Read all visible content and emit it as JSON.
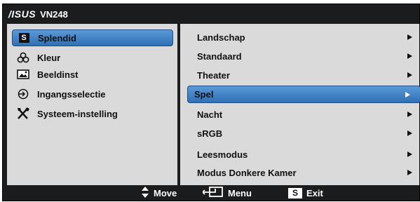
{
  "title": {
    "brand": "/ISUS",
    "model": "VN248"
  },
  "main_menu": [
    {
      "label": "Splendid",
      "icon": "splendid-s-icon",
      "selected": true
    },
    {
      "label": "Kleur",
      "icon": "color-icon",
      "selected": false
    },
    {
      "label": "Beeldinst",
      "icon": "image-icon",
      "selected": false
    },
    {
      "label": "Ingangsselectie",
      "icon": "input-icon",
      "selected": false
    },
    {
      "label": "Systeem-instelling",
      "icon": "tools-icon",
      "selected": false
    }
  ],
  "submenu": [
    {
      "label": "Landschap",
      "selected": false
    },
    {
      "label": "Standaard",
      "selected": false
    },
    {
      "label": "Theater",
      "selected": false
    },
    {
      "label": "Spel",
      "selected": true
    },
    {
      "label": "Nacht",
      "selected": false
    },
    {
      "label": "sRGB",
      "selected": false
    },
    {
      "label": "Leesmodus",
      "selected": false
    },
    {
      "label": "Modus Donkere Kamer",
      "selected": false
    }
  ],
  "footer": {
    "move_label": "Move",
    "menu_label": "Menu",
    "exit_label": "Exit",
    "exit_key": "S"
  },
  "splendid_key": "S",
  "colors": {
    "osd_bg": "#1a1c1e",
    "panel_bg": "#dadada",
    "highlight": "#3f7fc4"
  }
}
